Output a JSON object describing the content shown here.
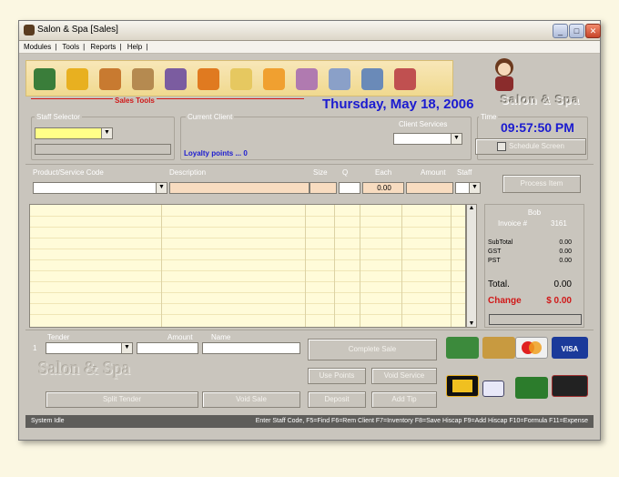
{
  "window": {
    "title": "Salon & Spa [Sales]",
    "minimize": "_",
    "maximize": "□",
    "close": "✕"
  },
  "menu": [
    "Modules",
    "Tools",
    "Reports",
    "Help"
  ],
  "toolbar": {
    "label": "Sales Tools",
    "icons": [
      "users-icon",
      "lightbulb-icon",
      "person-icon",
      "box-icon",
      "gift-icon",
      "truck-icon",
      "notepad-icon",
      "edit-icon",
      "chart-icon",
      "printer-icon",
      "calculator-icon",
      "door-icon"
    ]
  },
  "date": "Thursday, May 18, 2006",
  "brand": "Salon & Spa",
  "staff_selector": {
    "label": "Staff Selector",
    "value": ""
  },
  "current_client": {
    "label": "Current Client",
    "loyalty": "Loyalty points ... 0",
    "client_services_label": "Client Services"
  },
  "time": {
    "label": "Time",
    "value": "09:57:50 PM",
    "schedule_button": "Schedule Screen"
  },
  "item_entry": {
    "headers": {
      "product": "Product/Service Code",
      "description": "Description",
      "size": "Size",
      "q": "Q",
      "each": "Each",
      "amount": "Amount",
      "staff": "Staff"
    },
    "each_value": "0.00",
    "process_button": "Process Item"
  },
  "summary": {
    "staff": "Bob",
    "invoice_label": "Invoice #",
    "invoice": "3161",
    "subtotal_label": "SubTotal",
    "subtotal": "0.00",
    "gst_label": "GST",
    "gst": "0.00",
    "pst_label": "PST",
    "pst": "0.00",
    "total_label": "Total.",
    "total": "0.00",
    "change_label": "Change",
    "change": "$ 0.00"
  },
  "tender": {
    "label": "Tender",
    "amount_label": "Amount",
    "name_label": "Name",
    "row_num": "1"
  },
  "buttons": {
    "complete_sale": "Complete Sale",
    "use_points": "Use Points",
    "void_service": "Void Service",
    "split_tender": "Split Tender",
    "void_sale": "Void Sale",
    "deposit": "Deposit",
    "add_tip": "Add Tip"
  },
  "watermark": "Salon & Spa",
  "status": {
    "left": "System Idle",
    "right": "Enter Staff Code, F5=Find F6=Rem Client F7=Inventory F8=Save Hiscap F9=Add Hiscap F10=Formula F11=Expense"
  },
  "colors": {
    "accent": "#1b1bd0",
    "alert": "#d01818",
    "field_yellow": "#ffff88",
    "grid_bg": "#fffbd9"
  }
}
